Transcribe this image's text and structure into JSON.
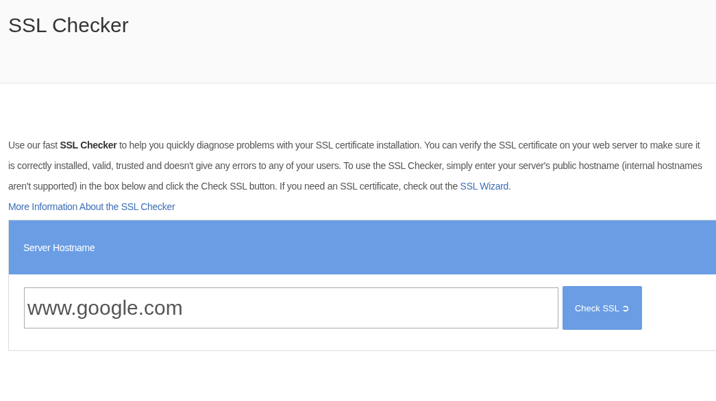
{
  "header": {
    "title": "SSL Checker"
  },
  "intro": {
    "text": "Use our fast **SSL Checker** to help you quickly diagnose problems with your SSL certificate installation. You can verify the SSL certificate on your web server to make sure it is correctly installed, valid, trusted and doesn't give any errors to any of your users. To use the SSL Checker, simply enter your server's public hostname (internal hostnames aren't supported) in the box below and click the Check SSL button. If you need an SSL certificate, check out the ",
    "link": "SSL Wizard",
    "after": "."
  },
  "more_link": "More Information About the SSL Checker",
  "panel": {
    "heading": "Server Hostname",
    "hostname_value": "www.google.com",
    "button": "Check SSL",
    "button_icon": "➲"
  }
}
